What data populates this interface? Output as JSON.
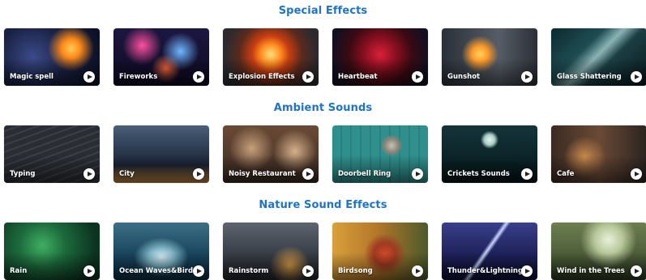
{
  "sections": [
    {
      "title": "Special Effects",
      "cards": [
        {
          "label": "Magic spell",
          "icon": "play-icon"
        },
        {
          "label": "Fireworks",
          "icon": "play-icon"
        },
        {
          "label": "Explosion Effects",
          "icon": "play-icon"
        },
        {
          "label": "Heartbeat",
          "icon": "play-icon"
        },
        {
          "label": "Gunshot",
          "icon": "play-icon"
        },
        {
          "label": "Glass Shattering",
          "icon": "play-icon"
        }
      ]
    },
    {
      "title": "Ambient Sounds",
      "cards": [
        {
          "label": "Typing",
          "icon": "play-icon"
        },
        {
          "label": "City",
          "icon": "play-icon"
        },
        {
          "label": "Noisy Restaurant",
          "icon": "play-icon"
        },
        {
          "label": "Doorbell Ring",
          "icon": "play-icon"
        },
        {
          "label": "Crickets Sounds",
          "icon": "play-icon"
        },
        {
          "label": "Cafe",
          "icon": "play-icon"
        }
      ]
    },
    {
      "title": "Nature Sound Effects",
      "cards": [
        {
          "label": "Rain",
          "icon": "play-icon"
        },
        {
          "label": "Ocean Waves&Bird",
          "icon": "play-icon"
        },
        {
          "label": "Rainstorm",
          "icon": "play-icon"
        },
        {
          "label": "Birdsong",
          "icon": "play-icon"
        },
        {
          "label": "Thunder&Lightning",
          "icon": "play-icon"
        },
        {
          "label": "Wind in the Trees",
          "icon": "play-icon"
        }
      ]
    }
  ],
  "colors": {
    "section_title": "#1f73c8",
    "card_label": "#ffffff",
    "play_button": "#ffffff"
  }
}
